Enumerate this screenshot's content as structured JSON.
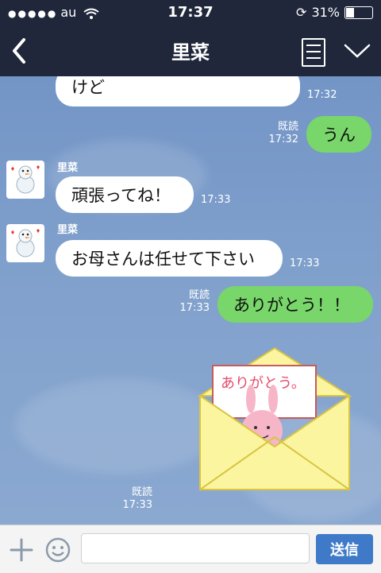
{
  "status": {
    "carrier": "au",
    "time": "17:37",
    "battery_percent": "31%",
    "battery_level": 0.31
  },
  "header": {
    "title": "里菜"
  },
  "messages": [
    {
      "side": "in",
      "text": "けど",
      "time": "17:32"
    },
    {
      "side": "out",
      "text": "うん",
      "read": "既読",
      "time": "17:32"
    },
    {
      "side": "in",
      "sender": "里菜",
      "text": "頑張ってね！",
      "time": "17:33"
    },
    {
      "side": "in",
      "sender": "里菜",
      "text": "お母さんは任せて下さい",
      "time": "17:33"
    },
    {
      "side": "out",
      "text": "ありがとう！！",
      "read": "既読",
      "time": "17:33"
    },
    {
      "side": "out",
      "sticker": "thank-you-bunny-envelope",
      "sticker_text": "ありがとう。",
      "read": "既読",
      "time": "17:33"
    }
  ],
  "composer": {
    "placeholder": "",
    "send_label": "送信"
  },
  "colors": {
    "header_bg": "#20273a",
    "chat_bg": "#7f9ec6",
    "out_bubble": "#78d66a",
    "in_bubble": "#ffffff",
    "send_button": "#3f7ac8"
  }
}
